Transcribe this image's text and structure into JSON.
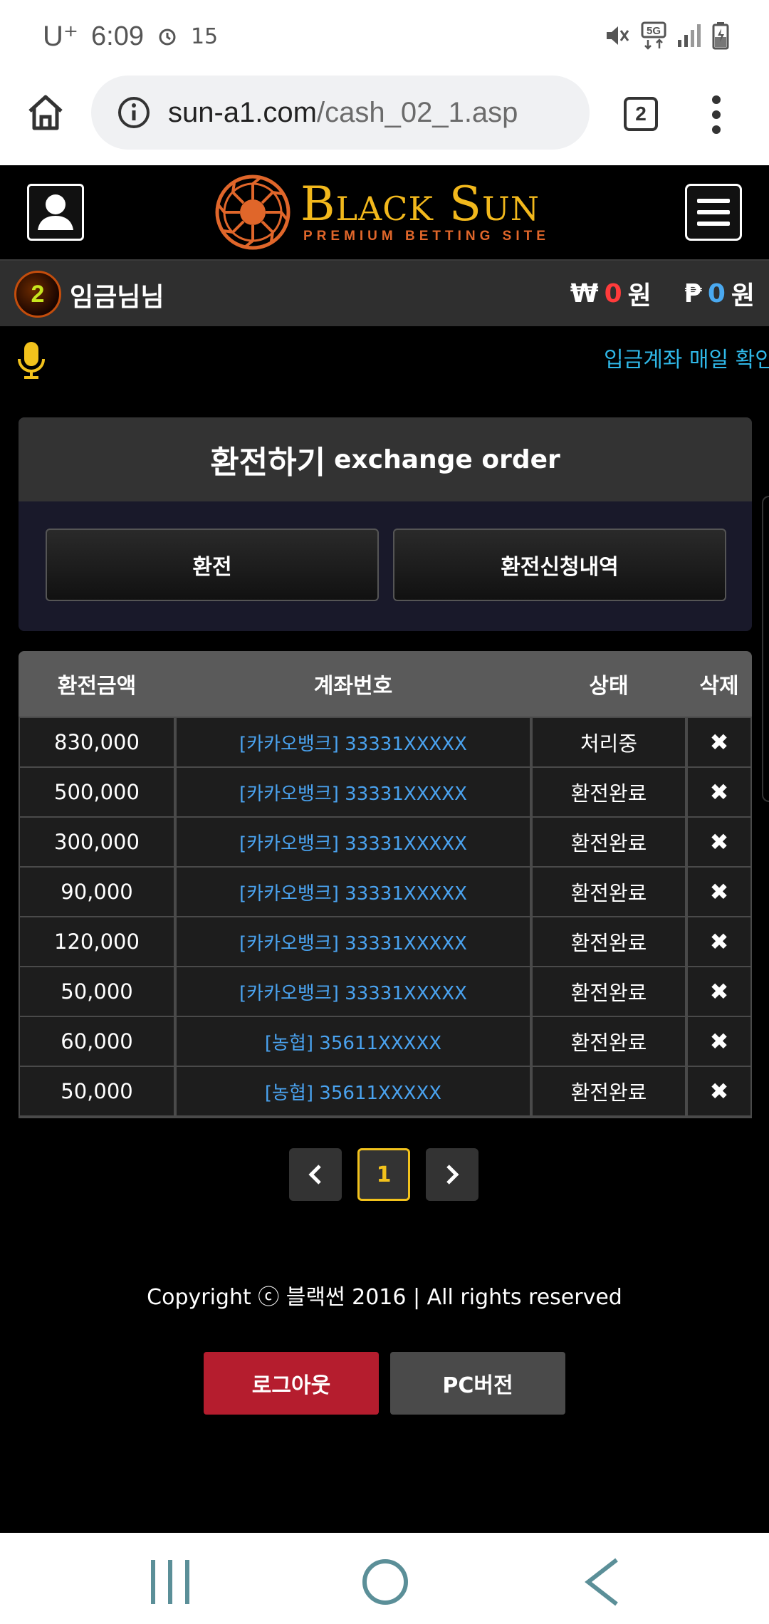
{
  "status_bar": {
    "carrier": "U⁺",
    "time": "6:09",
    "alarm_count": "15",
    "icons": [
      "alarm-icon",
      "mute-icon",
      "5g-icon",
      "signal-icon",
      "battery-icon"
    ]
  },
  "browser": {
    "url_domain": "sun-a1.com",
    "url_path": "/cash_02_1.asp",
    "tab_count": "2"
  },
  "header": {
    "logo_title": "Black Sun",
    "logo_subtitle": "PREMIUM BETTING SITE"
  },
  "user": {
    "level": "2",
    "name": "임금님님",
    "won_symbol": "₩",
    "won_value": "0",
    "won_unit": "원",
    "point_symbol": "₱",
    "point_value": "0",
    "point_unit": "원"
  },
  "notice": {
    "text": "입금계좌 매일 확인"
  },
  "panel": {
    "title_ko": "환전하기",
    "title_en": "exchange order",
    "btn_exchange": "환전",
    "btn_history": "환전신청내역"
  },
  "table": {
    "headers": [
      "환전금액",
      "계좌번호",
      "상태",
      "삭제"
    ],
    "rows": [
      {
        "amount": "830,000",
        "account": "[카카오뱅크] 33331XXXXX",
        "status": "처리중",
        "delete": "✖"
      },
      {
        "amount": "500,000",
        "account": "[카카오뱅크] 33331XXXXX",
        "status": "환전완료",
        "delete": "✖"
      },
      {
        "amount": "300,000",
        "account": "[카카오뱅크] 33331XXXXX",
        "status": "환전완료",
        "delete": "✖"
      },
      {
        "amount": "90,000",
        "account": "[카카오뱅크] 33331XXXXX",
        "status": "환전완료",
        "delete": "✖"
      },
      {
        "amount": "120,000",
        "account": "[카카오뱅크] 33331XXXXX",
        "status": "환전완료",
        "delete": "✖"
      },
      {
        "amount": "50,000",
        "account": "[카카오뱅크] 33331XXXXX",
        "status": "환전완료",
        "delete": "✖"
      },
      {
        "amount": "60,000",
        "account": "[농협] 35611XXXXX",
        "status": "환전완료",
        "delete": "✖"
      },
      {
        "amount": "50,000",
        "account": "[농협] 35611XXXXX",
        "status": "환전완료",
        "delete": "✖"
      }
    ]
  },
  "pagination": {
    "prev": "‹",
    "current": "1",
    "next": "›"
  },
  "footer": {
    "copyright": "Copyright ⓒ 블랙썬 2016 | All rights reserved",
    "logout": "로그아웃",
    "pc_version": "PC버전"
  },
  "colors": {
    "accent_gold": "#f2b81c",
    "won_red": "#ff3b3b",
    "point_blue": "#4aa9f0",
    "account_blue": "#4aa3f0",
    "logout_red": "#b51d2e"
  }
}
